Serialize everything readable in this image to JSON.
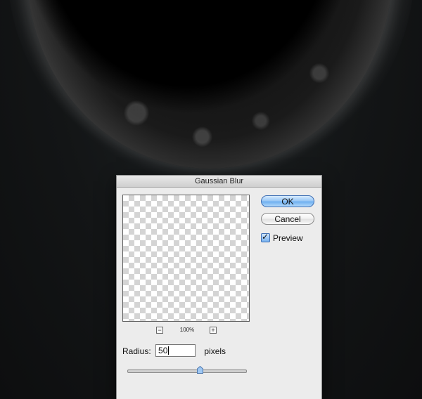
{
  "dialog": {
    "title": "Gaussian Blur",
    "ok_label": "OK",
    "cancel_label": "Cancel",
    "preview_label": "Preview",
    "preview_checked": true,
    "zoom_level": "100%",
    "zoom_out_symbol": "−",
    "zoom_in_symbol": "+",
    "radius_label": "Radius:",
    "radius_value": "50",
    "radius_unit": "pixels",
    "slider_fraction": 0.62
  },
  "colors": {
    "ok_button": "#6fb0f0",
    "dialog_bg": "#ececec",
    "background": "#121415"
  },
  "icons": {
    "checkmark": "checkmark-icon",
    "zoom_out": "minus-icon",
    "zoom_in": "plus-icon",
    "slider_thumb": "slider-thumb-icon"
  }
}
